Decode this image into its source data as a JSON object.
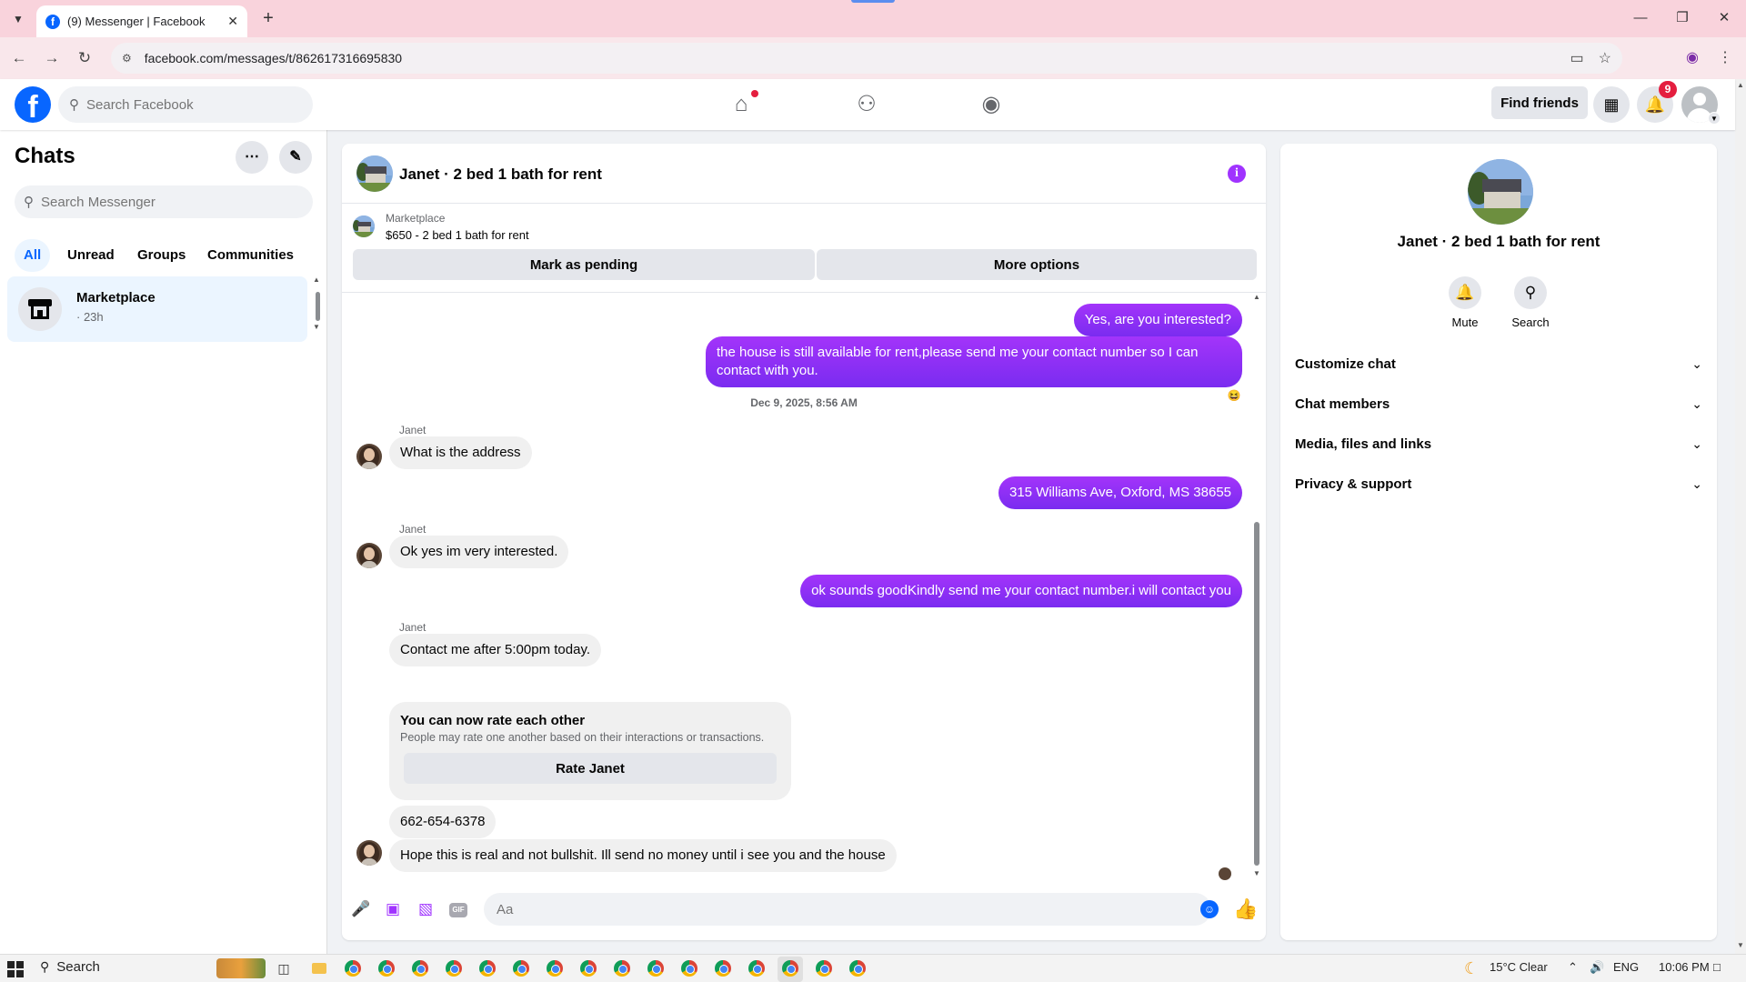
{
  "browser": {
    "tab_title": "(9) Messenger | Facebook",
    "url": "facebook.com/messages/t/862617316695830"
  },
  "fb_header": {
    "search_placeholder": "Search Facebook",
    "find_friends": "Find friends",
    "notification_count": "9"
  },
  "sidebar": {
    "title": "Chats",
    "search_placeholder": "Search Messenger",
    "filters": [
      {
        "label": "All",
        "active": true
      },
      {
        "label": "Unread",
        "active": false
      },
      {
        "label": "Groups",
        "active": false
      },
      {
        "label": "Communities",
        "active": false
      }
    ],
    "conversations": [
      {
        "name": "Marketplace",
        "time": "· 23h"
      }
    ]
  },
  "chat": {
    "title": "Janet · 2 bed 1 bath for rent",
    "listing": {
      "label": "Marketplace",
      "price_title": "$650 - 2 bed 1 bath for rent",
      "pending_button": "Mark as pending",
      "more_button": "More options"
    },
    "messages": {
      "out1": "Yes, are you interested?",
      "out2": "the house is still available for rent,please send me your contact number so I can contact with you.",
      "timestamp": "Dec 9, 2025, 8:56 AM",
      "sender1": "Janet",
      "in1": "What is the address",
      "out3": "315 Williams Ave, Oxford, MS 38655",
      "sender2": "Janet",
      "in2": "Ok yes im very interested.",
      "out4": "ok sounds goodKindly send me your contact number.i will contact you",
      "sender3": "Janet",
      "in3": "Contact me after 5:00pm today.",
      "rate_title": "You can now rate each other",
      "rate_sub": "People may rate one another based on their interactions or transactions.",
      "rate_button": "Rate Janet",
      "in4": "662-654-6378",
      "in5": "Hope this is real and not bullshit. Ill send no money until i see you and the house"
    },
    "composer_placeholder": "Aa",
    "gif_label": "GIF"
  },
  "right_panel": {
    "title": "Janet · 2 bed 1 bath for rent",
    "actions": [
      {
        "label": "Mute",
        "icon": "bell-icon"
      },
      {
        "label": "Search",
        "icon": "search-icon"
      }
    ],
    "sections": [
      "Customize chat",
      "Chat members",
      "Media, files and links",
      "Privacy & support"
    ]
  },
  "taskbar": {
    "search_label": "Search",
    "weather": "15°C  Clear",
    "language": "ENG",
    "time": "10:06 PM"
  },
  "colors": {
    "fb_blue": "#0866ff",
    "messenger_purple": "#a033ff",
    "active_chat_bg": "#ebf5ff",
    "badge_red": "#e41e3f"
  }
}
